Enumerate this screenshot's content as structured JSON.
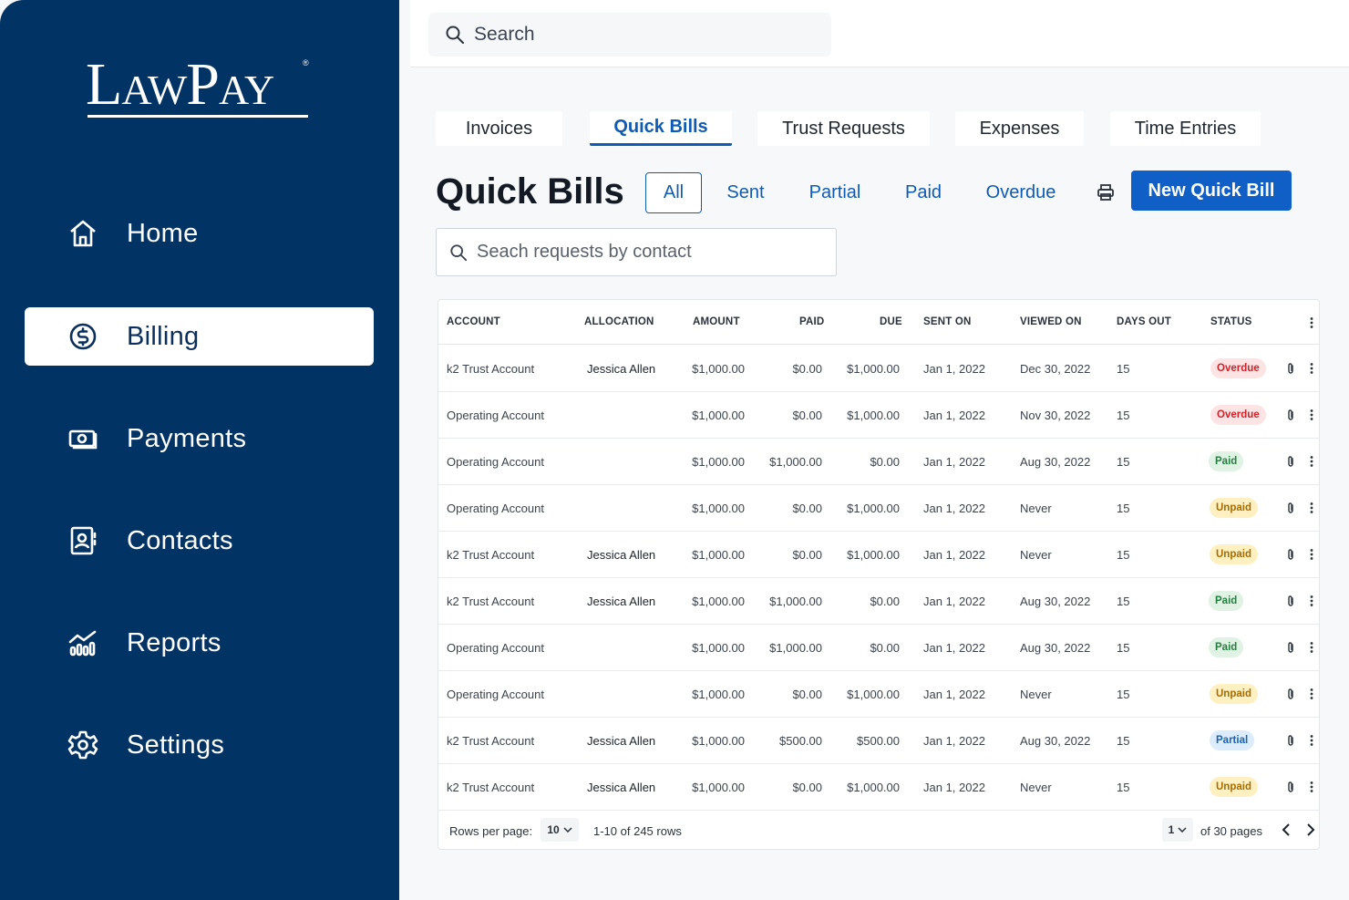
{
  "brand": {
    "logo_text": "LawPay",
    "logo_mark": "®"
  },
  "sidebar": {
    "items": [
      {
        "label": "Home",
        "icon": "home-icon",
        "active": false
      },
      {
        "label": "Billing",
        "icon": "dollar-circle-icon",
        "active": true
      },
      {
        "label": "Payments",
        "icon": "cash-icon",
        "active": false
      },
      {
        "label": "Contacts",
        "icon": "contact-card-icon",
        "active": false
      },
      {
        "label": "Reports",
        "icon": "chart-icon",
        "active": false
      },
      {
        "label": "Settings",
        "icon": "gear-icon",
        "active": false
      }
    ]
  },
  "topbar": {
    "search_placeholder": "Search"
  },
  "tabs": [
    {
      "label": "Invoices",
      "active": false
    },
    {
      "label": "Quick Bills",
      "active": true
    },
    {
      "label": "Trust Requests",
      "active": false
    },
    {
      "label": "Expenses",
      "active": false
    },
    {
      "label": "Time Entries",
      "active": false
    }
  ],
  "page": {
    "title": "Quick Bills",
    "filters": [
      "All",
      "Sent",
      "Partial",
      "Paid",
      "Overdue"
    ],
    "active_filter": "All",
    "new_button": "New Quick Bill",
    "contact_search_placeholder": "Seach requests by contact"
  },
  "table": {
    "columns": [
      "ACCOUNT",
      "ALLOCATION",
      "AMOUNT",
      "PAID",
      "DUE",
      "SENT ON",
      "VIEWED ON",
      "DAYS OUT",
      "STATUS"
    ],
    "rows": [
      {
        "account": "k2 Trust Account",
        "allocation": "Jessica Allen",
        "amount": "$1,000.00",
        "paid": "$0.00",
        "due": "$1,000.00",
        "sent_on": "Jan 1, 2022",
        "viewed_on": "Dec 30, 2022",
        "days_out": "15",
        "status": "Overdue"
      },
      {
        "account": "Operating Account",
        "allocation": "",
        "amount": "$1,000.00",
        "paid": "$0.00",
        "due": "$1,000.00",
        "sent_on": "Jan 1, 2022",
        "viewed_on": "Nov 30, 2022",
        "days_out": "15",
        "status": "Overdue"
      },
      {
        "account": "Operating Account",
        "allocation": "",
        "amount": "$1,000.00",
        "paid": "$1,000.00",
        "due": "$0.00",
        "sent_on": "Jan 1, 2022",
        "viewed_on": "Aug 30, 2022",
        "days_out": "15",
        "status": "Paid"
      },
      {
        "account": "Operating Account",
        "allocation": "",
        "amount": "$1,000.00",
        "paid": "$0.00",
        "due": "$1,000.00",
        "sent_on": "Jan 1, 2022",
        "viewed_on": "Never",
        "days_out": "15",
        "status": "Unpaid"
      },
      {
        "account": "k2 Trust Account",
        "allocation": "Jessica Allen",
        "amount": "$1,000.00",
        "paid": "$0.00",
        "due": "$1,000.00",
        "sent_on": "Jan 1, 2022",
        "viewed_on": "Never",
        "days_out": "15",
        "status": "Unpaid"
      },
      {
        "account": "k2 Trust Account",
        "allocation": "Jessica Allen",
        "amount": "$1,000.00",
        "paid": "$1,000.00",
        "due": "$0.00",
        "sent_on": "Jan 1, 2022",
        "viewed_on": "Aug 30, 2022",
        "days_out": "15",
        "status": "Paid"
      },
      {
        "account": "Operating Account",
        "allocation": "",
        "amount": "$1,000.00",
        "paid": "$1,000.00",
        "due": "$0.00",
        "sent_on": "Jan 1, 2022",
        "viewed_on": "Aug 30, 2022",
        "days_out": "15",
        "status": "Paid"
      },
      {
        "account": "Operating Account",
        "allocation": "",
        "amount": "$1,000.00",
        "paid": "$0.00",
        "due": "$1,000.00",
        "sent_on": "Jan 1, 2022",
        "viewed_on": "Never",
        "days_out": "15",
        "status": "Unpaid"
      },
      {
        "account": "k2 Trust Account",
        "allocation": "Jessica Allen",
        "amount": "$1,000.00",
        "paid": "$500.00",
        "due": "$500.00",
        "sent_on": "Jan 1, 2022",
        "viewed_on": "Aug 30, 2022",
        "days_out": "15",
        "status": "Partial"
      },
      {
        "account": "k2 Trust Account",
        "allocation": "Jessica Allen",
        "amount": "$1,000.00",
        "paid": "$0.00",
        "due": "$1,000.00",
        "sent_on": "Jan 1, 2022",
        "viewed_on": "Never",
        "days_out": "15",
        "status": "Unpaid"
      }
    ]
  },
  "footer": {
    "rows_per_page_label": "Rows per page:",
    "rows_per_page_value": "10",
    "range_text": "1-10 of 245 rows",
    "page_value": "1",
    "pages_text": "of 30 pages"
  },
  "colors": {
    "sidebar_bg": "#023365",
    "accent": "#0f5fc7",
    "overdue": "#d0222a",
    "paid": "#23803f",
    "unpaid": "#a86b00",
    "partial": "#1a63b5"
  }
}
